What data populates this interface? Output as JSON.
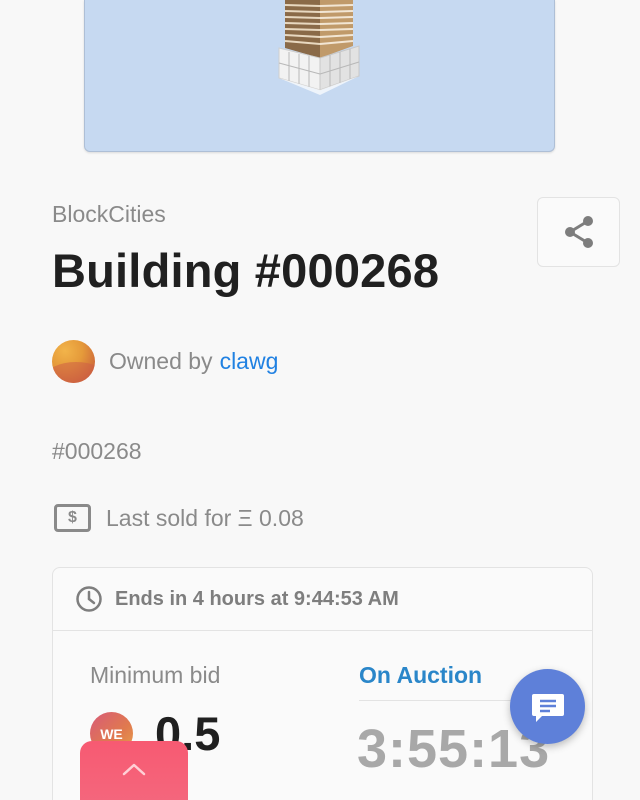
{
  "asset": {
    "collection": "BlockCities",
    "title": "Building #000268",
    "owner_prefix": "Owned by",
    "owner_name": "clawg",
    "token_id": "#000268",
    "last_sold": "Last sold for Ξ 0.08"
  },
  "auction": {
    "ends_text": "Ends in 4 hours at 9:44:53 AM",
    "min_bid_label": "Minimum bid",
    "token_symbol": "WE",
    "min_bid_value": "0.5",
    "status": "On Auction",
    "countdown": "3:55:13"
  },
  "icons": {
    "share": "share-icon",
    "clock": "clock-icon",
    "dollar": "dollar-icon",
    "chat": "chat-icon",
    "chevron_up": "chevron-up-icon"
  },
  "colors": {
    "link": "#2081e2",
    "status": "#2a86c9",
    "chat_button": "#5e80d9",
    "up_button": "#f75a72",
    "hero_bg": "#c6d9f1"
  }
}
